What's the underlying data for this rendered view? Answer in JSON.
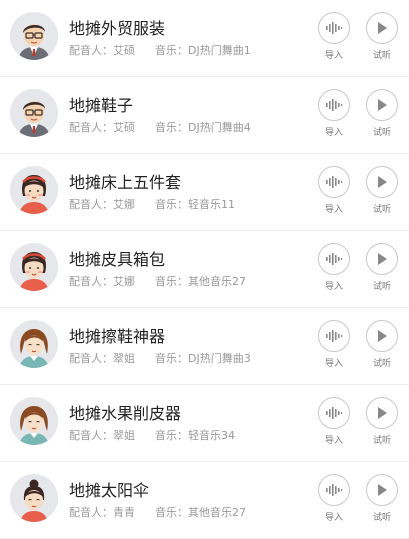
{
  "labels": {
    "voice_prefix": "配音人：",
    "music_prefix": "音乐："
  },
  "actions": {
    "import_label": "导入",
    "listen_label": "试听"
  },
  "items": [
    {
      "title": "地摊外贸服装",
      "voice": "艾硕",
      "music": "DJ热门舞曲1",
      "avatar": "male-glasses-avatar"
    },
    {
      "title": "地摊鞋子",
      "voice": "艾硕",
      "music": "DJ热门舞曲4",
      "avatar": "male-glasses-avatar"
    },
    {
      "title": "地摊床上五件套",
      "voice": "艾娜",
      "music": "轻音乐11",
      "avatar": "girl-headband-avatar"
    },
    {
      "title": "地摊皮具箱包",
      "voice": "艾娜",
      "music": "其他音乐27",
      "avatar": "girl-headband-avatar"
    },
    {
      "title": "地摊擦鞋神器",
      "voice": "翠姐",
      "music": "DJ热门舞曲3",
      "avatar": "woman-brown-hair-avatar"
    },
    {
      "title": "地摊水果削皮器",
      "voice": "翠姐",
      "music": "轻音乐34",
      "avatar": "woman-brown-hair-avatar"
    },
    {
      "title": "地摊太阳伞",
      "voice": "青青",
      "music": "其他音乐27",
      "avatar": "girl-bun-avatar"
    }
  ]
}
